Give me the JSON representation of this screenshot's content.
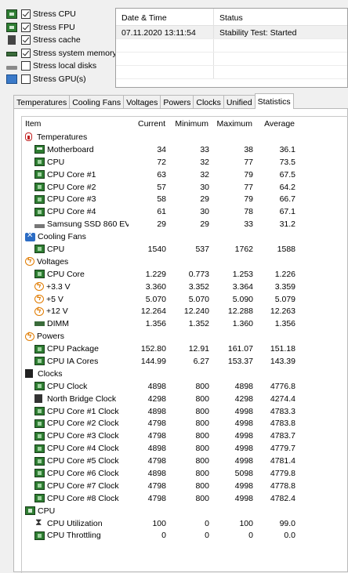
{
  "stress_options": [
    {
      "label": "Stress CPU",
      "checked": true,
      "icon": "cpu-chip-icon"
    },
    {
      "label": "Stress FPU",
      "checked": true,
      "icon": "fpu-chip-icon"
    },
    {
      "label": "Stress cache",
      "checked": true,
      "icon": "cache-chip-icon"
    },
    {
      "label": "Stress system memory",
      "checked": true,
      "icon": "memory-module-icon"
    },
    {
      "label": "Stress local disks",
      "checked": false,
      "icon": "disk-drive-icon"
    },
    {
      "label": "Stress GPU(s)",
      "checked": false,
      "icon": "gpu-monitor-icon"
    }
  ],
  "status_panel": {
    "col_datetime": "Date & Time",
    "col_status": "Status",
    "rows": [
      {
        "datetime": "07.11.2020 13:11:54",
        "status": "Stability Test: Started"
      },
      {
        "datetime": "",
        "status": ""
      },
      {
        "datetime": "",
        "status": ""
      },
      {
        "datetime": "",
        "status": ""
      }
    ]
  },
  "tabs": [
    {
      "label": "Temperatures",
      "active": false
    },
    {
      "label": "Cooling Fans",
      "active": false
    },
    {
      "label": "Voltages",
      "active": false
    },
    {
      "label": "Powers",
      "active": false
    },
    {
      "label": "Clocks",
      "active": false
    },
    {
      "label": "Unified",
      "active": false
    },
    {
      "label": "Statistics",
      "active": true
    }
  ],
  "statistics": {
    "headers": {
      "item": "Item",
      "current": "Current",
      "minimum": "Minimum",
      "maximum": "Maximum",
      "average": "Average"
    },
    "rows": [
      {
        "type": "group",
        "icon": "therm",
        "label": "Temperatures"
      },
      {
        "type": "item",
        "icon": "mobo",
        "label": "Motherboard",
        "current": "34",
        "min": "33",
        "max": "38",
        "avg": "36.1"
      },
      {
        "type": "item",
        "icon": "chip",
        "label": "CPU",
        "current": "72",
        "min": "32",
        "max": "77",
        "avg": "73.5"
      },
      {
        "type": "item",
        "icon": "chip",
        "label": "CPU Core #1",
        "current": "63",
        "min": "32",
        "max": "79",
        "avg": "67.5"
      },
      {
        "type": "item",
        "icon": "chip",
        "label": "CPU Core #2",
        "current": "57",
        "min": "30",
        "max": "77",
        "avg": "64.2"
      },
      {
        "type": "item",
        "icon": "chip",
        "label": "CPU Core #3",
        "current": "58",
        "min": "29",
        "max": "79",
        "avg": "66.7"
      },
      {
        "type": "item",
        "icon": "chip",
        "label": "CPU Core #4",
        "current": "61",
        "min": "30",
        "max": "78",
        "avg": "67.1"
      },
      {
        "type": "item",
        "icon": "ssd",
        "label": "Samsung SSD 860 EV...",
        "current": "29",
        "min": "29",
        "max": "33",
        "avg": "31.2"
      },
      {
        "type": "group",
        "icon": "fan",
        "label": "Cooling Fans"
      },
      {
        "type": "item",
        "icon": "chip",
        "label": "CPU",
        "current": "1540",
        "min": "537",
        "max": "1762",
        "avg": "1588"
      },
      {
        "type": "group",
        "icon": "bolt",
        "label": "Voltages"
      },
      {
        "type": "item",
        "icon": "chip",
        "label": "CPU Core",
        "current": "1.229",
        "min": "0.773",
        "max": "1.253",
        "avg": "1.226"
      },
      {
        "type": "item",
        "icon": "bolt",
        "label": "+3.3 V",
        "current": "3.360",
        "min": "3.352",
        "max": "3.364",
        "avg": "3.359"
      },
      {
        "type": "item",
        "icon": "bolt",
        "label": "+5 V",
        "current": "5.070",
        "min": "5.070",
        "max": "5.090",
        "avg": "5.079"
      },
      {
        "type": "item",
        "icon": "bolt",
        "label": "+12 V",
        "current": "12.264",
        "min": "12.240",
        "max": "12.288",
        "avg": "12.263"
      },
      {
        "type": "item",
        "icon": "dimm",
        "label": "DIMM",
        "current": "1.356",
        "min": "1.352",
        "max": "1.360",
        "avg": "1.356"
      },
      {
        "type": "group",
        "icon": "bolt",
        "label": "Powers"
      },
      {
        "type": "item",
        "icon": "chip",
        "label": "CPU Package",
        "current": "152.80",
        "min": "12.91",
        "max": "161.07",
        "avg": "151.18"
      },
      {
        "type": "item",
        "icon": "chip",
        "label": "CPU IA Cores",
        "current": "144.99",
        "min": "6.27",
        "max": "153.37",
        "avg": "143.39"
      },
      {
        "type": "group",
        "icon": "clock",
        "label": "Clocks"
      },
      {
        "type": "item",
        "icon": "chip",
        "label": "CPU Clock",
        "current": "4898",
        "min": "800",
        "max": "4898",
        "avg": "4776.8"
      },
      {
        "type": "item",
        "icon": "nbridge",
        "label": "North Bridge Clock",
        "current": "4298",
        "min": "800",
        "max": "4298",
        "avg": "4274.4"
      },
      {
        "type": "item",
        "icon": "chip",
        "label": "CPU Core #1 Clock",
        "current": "4898",
        "min": "800",
        "max": "4998",
        "avg": "4783.3"
      },
      {
        "type": "item",
        "icon": "chip",
        "label": "CPU Core #2 Clock",
        "current": "4798",
        "min": "800",
        "max": "4998",
        "avg": "4783.8"
      },
      {
        "type": "item",
        "icon": "chip",
        "label": "CPU Core #3 Clock",
        "current": "4798",
        "min": "800",
        "max": "4998",
        "avg": "4783.7"
      },
      {
        "type": "item",
        "icon": "chip",
        "label": "CPU Core #4 Clock",
        "current": "4898",
        "min": "800",
        "max": "4998",
        "avg": "4779.7"
      },
      {
        "type": "item",
        "icon": "chip",
        "label": "CPU Core #5 Clock",
        "current": "4798",
        "min": "800",
        "max": "4998",
        "avg": "4781.4"
      },
      {
        "type": "item",
        "icon": "chip",
        "label": "CPU Core #6 Clock",
        "current": "4898",
        "min": "800",
        "max": "5098",
        "avg": "4779.8"
      },
      {
        "type": "item",
        "icon": "chip",
        "label": "CPU Core #7 Clock",
        "current": "4798",
        "min": "800",
        "max": "4998",
        "avg": "4778.8"
      },
      {
        "type": "item",
        "icon": "chip",
        "label": "CPU Core #8 Clock",
        "current": "4798",
        "min": "800",
        "max": "4998",
        "avg": "4782.4"
      },
      {
        "type": "group",
        "icon": "cpubig",
        "label": "CPU"
      },
      {
        "type": "item",
        "icon": "hourglass",
        "label": "CPU Utilization",
        "current": "100",
        "min": "0",
        "max": "100",
        "avg": "99.0"
      },
      {
        "type": "item",
        "icon": "chip",
        "label": "CPU Throttling",
        "current": "0",
        "min": "0",
        "max": "0",
        "avg": "0.0"
      }
    ]
  }
}
